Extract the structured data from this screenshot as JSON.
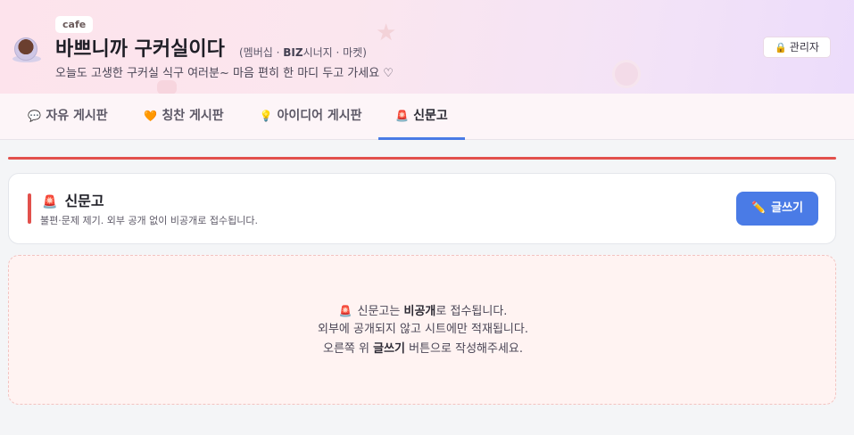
{
  "header": {
    "tag": "cafe",
    "title": "바쁘니까 구커실이다",
    "subtitle_pre": "(멤버십 · ",
    "subtitle_bold": "BIZ",
    "subtitle_post": "시너지 · 마켓)",
    "tagline": "오늘도 고생한 구커실 식구 여러분~ 마음 편히 한 마디 두고 가세요 ♡",
    "admin_label": "관리자",
    "admin_icon": "🔒"
  },
  "tabs": [
    {
      "icon": "💬",
      "label": "자유 게시판"
    },
    {
      "icon": "🧡",
      "label": "칭찬 게시판"
    },
    {
      "icon": "💡",
      "label": "아이디어 게시판"
    },
    {
      "icon": "🚨",
      "label": "신문고"
    }
  ],
  "active_tab": "신문고",
  "board": {
    "icon": "🚨",
    "title": "신문고",
    "description": "불편·문제 제기. 외부 공개 없이 비공개로 접수됩니다.",
    "write_icon": "✏️",
    "write_label": "글쓰기"
  },
  "notice": {
    "icon": "🚨",
    "line1_pre": "신문고는 ",
    "line1_bold": "비공개",
    "line1_post": "로 접수됩니다.",
    "line2": "외부에 공개되지 않고 시트에만 적재됩니다.",
    "line3_pre": "오른쪽 위 ",
    "line3_bold": "글쓰기",
    "line3_post": " 버튼으로 작성해주세요."
  },
  "colors": {
    "accent": "#4a7be6",
    "alert_red": "#e2504c",
    "notice_bg": "#fff3f2"
  }
}
